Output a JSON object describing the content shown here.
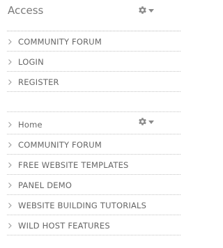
{
  "access_widget": {
    "title": "Access",
    "gear_icon": "gear-icon",
    "items": [
      {
        "label": "COMMUNITY FORUM"
      },
      {
        "label": "LOGIN"
      },
      {
        "label": "REGISTER"
      }
    ]
  },
  "nav_widget": {
    "gear_icon": "gear-icon",
    "items": [
      {
        "label": "Home"
      },
      {
        "label": "COMMUNITY FORUM"
      },
      {
        "label": "FREE WEBSITE TEMPLATES"
      },
      {
        "label": "PANEL DEMO"
      },
      {
        "label": "WEBSITE BUILDING TUTORIALS"
      },
      {
        "label": "WILD HOST FEATURES"
      }
    ]
  },
  "colors": {
    "text": "#666666",
    "title": "#7a7a7a",
    "icon": "#888888",
    "divider": "#c4c4c4"
  }
}
